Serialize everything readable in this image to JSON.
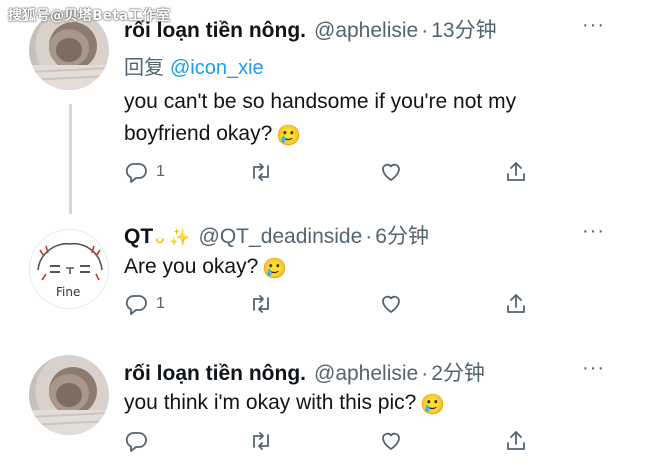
{
  "watermark": "搜狐号@贝塔Beta工作室",
  "tweets": [
    {
      "name": "rối loạn tiền nông.",
      "handle": "@aphelisie",
      "time": "13分钟",
      "reply_prefix": "回复",
      "reply_mention": "@icon_xie",
      "text_line1": "you can't be so handsome if you're not my",
      "text_line2": "boyfriend okay?",
      "emoji": "🥲",
      "reply_count": "1",
      "more": "···"
    },
    {
      "name": "QT",
      "name_symbols": "ᴗ ✨",
      "handle": "@QT_deadinside",
      "time": "6分钟",
      "text_line1": "Are you okay?",
      "emoji": "🥲",
      "reply_count": "1",
      "more": "···",
      "avatar_text": "Fine"
    },
    {
      "name": "rối loạn tiền nông.",
      "handle": "@aphelisie",
      "time": "2分钟",
      "text_line1": "you think i'm okay with this pic?",
      "emoji": "🥲",
      "more": "···"
    }
  ],
  "icons": {
    "reply": "reply-icon",
    "retweet": "retweet-icon",
    "like": "heart-icon",
    "share": "share-icon",
    "more": "more-icon"
  },
  "colors": {
    "text": "#0f1419",
    "secondary": "#536471",
    "link": "#1d9bf0",
    "thread_line": "#cfd9de"
  }
}
